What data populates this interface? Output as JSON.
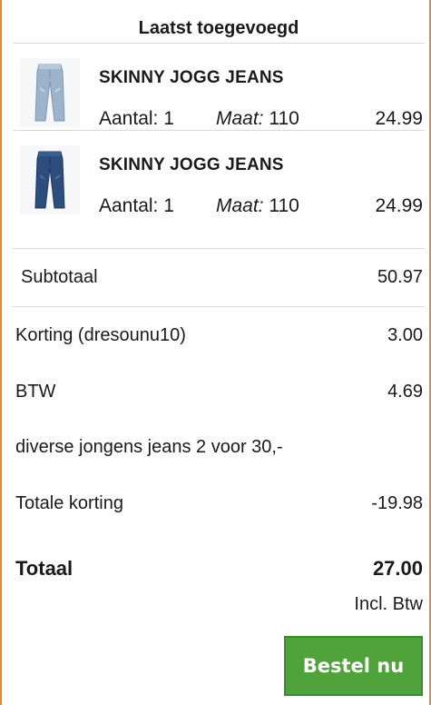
{
  "cart": {
    "title": "Laatst toegevoegd",
    "items": [
      {
        "name": "SKINNY JOGG JEANS",
        "qty_label": "Aantal: 1",
        "size_label": "Maat:",
        "size_value": "110",
        "price": "24.99",
        "image_icon": "light-wash-jeans-image"
      },
      {
        "name": "SKINNY JOGG JEANS",
        "qty_label": "Aantal: 1",
        "size_label": "Maat:",
        "size_value": "110",
        "price": "24.99",
        "image_icon": "dark-wash-jeans-image"
      }
    ],
    "summary": {
      "subtotal_label": "Subtotaal",
      "subtotal_value": "50.97",
      "discount_label": "Korting (dresounu10)",
      "discount_value": "3.00",
      "vat_label": "BTW",
      "vat_value": "4.69",
      "promo_label": "diverse jongens jeans 2 voor 30,-",
      "total_discount_label": "Totale korting",
      "total_discount_value": "-19.98",
      "total_label": "Totaal",
      "total_value": "27.00",
      "incl_vat": "Incl. Btw"
    },
    "order_button": "Bestel nu",
    "colors": {
      "accent_green": "#4fa33a",
      "frame_orange": "#e08a3c",
      "divider": "#d9d9d9"
    }
  }
}
